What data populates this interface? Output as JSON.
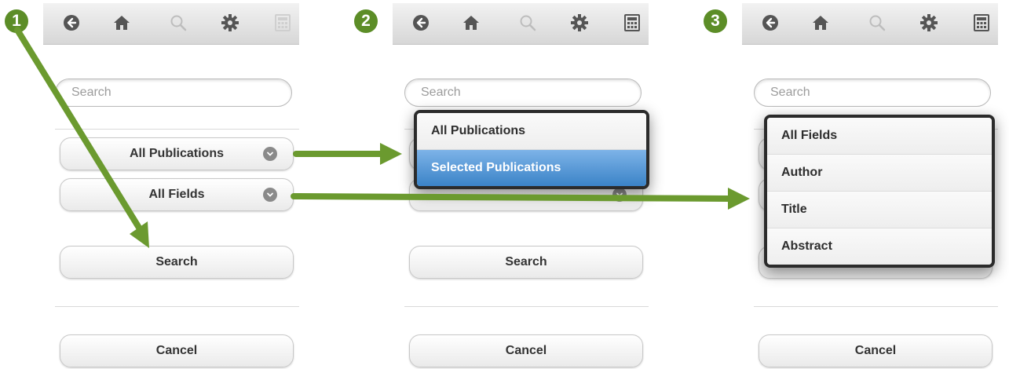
{
  "toolbar": {
    "icons": [
      "back-icon",
      "home-icon",
      "search-icon",
      "gear-icon",
      "calculator-icon"
    ]
  },
  "step_numbers": [
    "1",
    "2",
    "3"
  ],
  "panel1": {
    "search_placeholder": "Search",
    "scope_select": "All Publications",
    "field_select": "All Fields",
    "search_button": "Search",
    "cancel_button": "Cancel"
  },
  "panel2": {
    "search_placeholder": "Search",
    "popup_options": [
      "All Publications",
      "Selected Publications"
    ],
    "selected_option": "Selected Publications",
    "search_button": "Search",
    "cancel_button": "Cancel"
  },
  "panel3": {
    "search_placeholder": "Search",
    "popup_options": [
      "All Fields",
      "Author",
      "Title",
      "Abstract"
    ],
    "cancel_button": "Cancel"
  },
  "colors": {
    "arrow": "#6b9a2f",
    "step_badge": "#5c8d27",
    "selected_option": "#3b83c7"
  }
}
